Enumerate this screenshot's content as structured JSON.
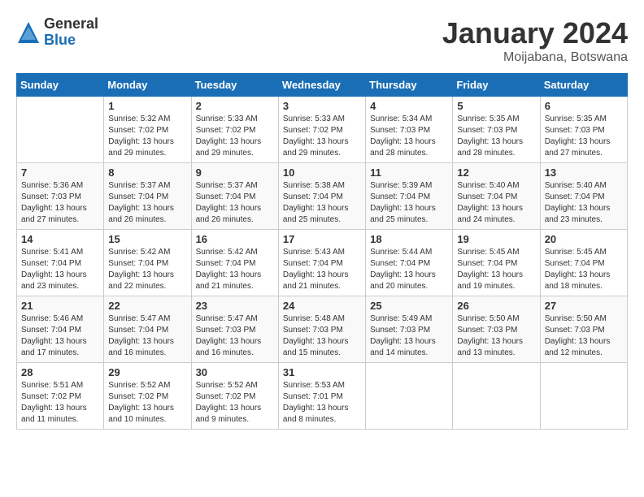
{
  "logo": {
    "general": "General",
    "blue": "Blue"
  },
  "title": "January 2024",
  "location": "Moijabana, Botswana",
  "weekdays": [
    "Sunday",
    "Monday",
    "Tuesday",
    "Wednesday",
    "Thursday",
    "Friday",
    "Saturday"
  ],
  "weeks": [
    [
      {
        "day": "",
        "info": ""
      },
      {
        "day": "1",
        "info": "Sunrise: 5:32 AM\nSunset: 7:02 PM\nDaylight: 13 hours\nand 29 minutes."
      },
      {
        "day": "2",
        "info": "Sunrise: 5:33 AM\nSunset: 7:02 PM\nDaylight: 13 hours\nand 29 minutes."
      },
      {
        "day": "3",
        "info": "Sunrise: 5:33 AM\nSunset: 7:02 PM\nDaylight: 13 hours\nand 29 minutes."
      },
      {
        "day": "4",
        "info": "Sunrise: 5:34 AM\nSunset: 7:03 PM\nDaylight: 13 hours\nand 28 minutes."
      },
      {
        "day": "5",
        "info": "Sunrise: 5:35 AM\nSunset: 7:03 PM\nDaylight: 13 hours\nand 28 minutes."
      },
      {
        "day": "6",
        "info": "Sunrise: 5:35 AM\nSunset: 7:03 PM\nDaylight: 13 hours\nand 27 minutes."
      }
    ],
    [
      {
        "day": "7",
        "info": "Sunrise: 5:36 AM\nSunset: 7:03 PM\nDaylight: 13 hours\nand 27 minutes."
      },
      {
        "day": "8",
        "info": "Sunrise: 5:37 AM\nSunset: 7:04 PM\nDaylight: 13 hours\nand 26 minutes."
      },
      {
        "day": "9",
        "info": "Sunrise: 5:37 AM\nSunset: 7:04 PM\nDaylight: 13 hours\nand 26 minutes."
      },
      {
        "day": "10",
        "info": "Sunrise: 5:38 AM\nSunset: 7:04 PM\nDaylight: 13 hours\nand 25 minutes."
      },
      {
        "day": "11",
        "info": "Sunrise: 5:39 AM\nSunset: 7:04 PM\nDaylight: 13 hours\nand 25 minutes."
      },
      {
        "day": "12",
        "info": "Sunrise: 5:40 AM\nSunset: 7:04 PM\nDaylight: 13 hours\nand 24 minutes."
      },
      {
        "day": "13",
        "info": "Sunrise: 5:40 AM\nSunset: 7:04 PM\nDaylight: 13 hours\nand 23 minutes."
      }
    ],
    [
      {
        "day": "14",
        "info": "Sunrise: 5:41 AM\nSunset: 7:04 PM\nDaylight: 13 hours\nand 23 minutes."
      },
      {
        "day": "15",
        "info": "Sunrise: 5:42 AM\nSunset: 7:04 PM\nDaylight: 13 hours\nand 22 minutes."
      },
      {
        "day": "16",
        "info": "Sunrise: 5:42 AM\nSunset: 7:04 PM\nDaylight: 13 hours\nand 21 minutes."
      },
      {
        "day": "17",
        "info": "Sunrise: 5:43 AM\nSunset: 7:04 PM\nDaylight: 13 hours\nand 21 minutes."
      },
      {
        "day": "18",
        "info": "Sunrise: 5:44 AM\nSunset: 7:04 PM\nDaylight: 13 hours\nand 20 minutes."
      },
      {
        "day": "19",
        "info": "Sunrise: 5:45 AM\nSunset: 7:04 PM\nDaylight: 13 hours\nand 19 minutes."
      },
      {
        "day": "20",
        "info": "Sunrise: 5:45 AM\nSunset: 7:04 PM\nDaylight: 13 hours\nand 18 minutes."
      }
    ],
    [
      {
        "day": "21",
        "info": "Sunrise: 5:46 AM\nSunset: 7:04 PM\nDaylight: 13 hours\nand 17 minutes."
      },
      {
        "day": "22",
        "info": "Sunrise: 5:47 AM\nSunset: 7:04 PM\nDaylight: 13 hours\nand 16 minutes."
      },
      {
        "day": "23",
        "info": "Sunrise: 5:47 AM\nSunset: 7:03 PM\nDaylight: 13 hours\nand 16 minutes."
      },
      {
        "day": "24",
        "info": "Sunrise: 5:48 AM\nSunset: 7:03 PM\nDaylight: 13 hours\nand 15 minutes."
      },
      {
        "day": "25",
        "info": "Sunrise: 5:49 AM\nSunset: 7:03 PM\nDaylight: 13 hours\nand 14 minutes."
      },
      {
        "day": "26",
        "info": "Sunrise: 5:50 AM\nSunset: 7:03 PM\nDaylight: 13 hours\nand 13 minutes."
      },
      {
        "day": "27",
        "info": "Sunrise: 5:50 AM\nSunset: 7:03 PM\nDaylight: 13 hours\nand 12 minutes."
      }
    ],
    [
      {
        "day": "28",
        "info": "Sunrise: 5:51 AM\nSunset: 7:02 PM\nDaylight: 13 hours\nand 11 minutes."
      },
      {
        "day": "29",
        "info": "Sunrise: 5:52 AM\nSunset: 7:02 PM\nDaylight: 13 hours\nand 10 minutes."
      },
      {
        "day": "30",
        "info": "Sunrise: 5:52 AM\nSunset: 7:02 PM\nDaylight: 13 hours\nand 9 minutes."
      },
      {
        "day": "31",
        "info": "Sunrise: 5:53 AM\nSunset: 7:01 PM\nDaylight: 13 hours\nand 8 minutes."
      },
      {
        "day": "",
        "info": ""
      },
      {
        "day": "",
        "info": ""
      },
      {
        "day": "",
        "info": ""
      }
    ]
  ]
}
